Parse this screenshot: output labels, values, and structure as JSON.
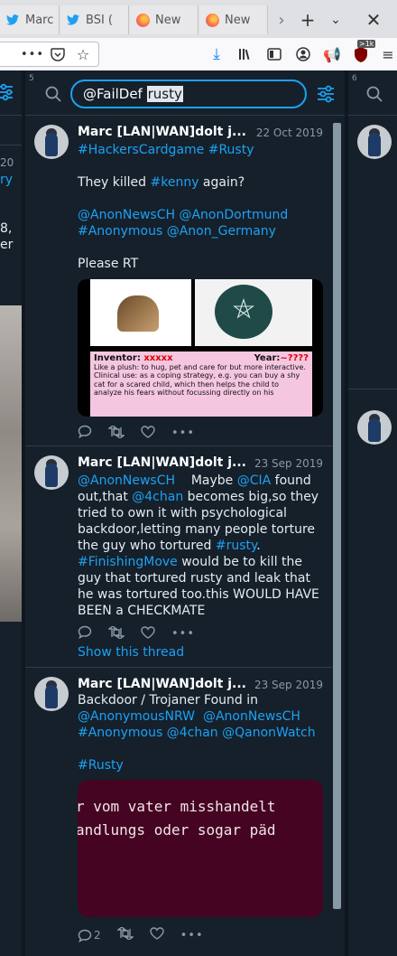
{
  "browser": {
    "tabs": [
      {
        "label": "Marc",
        "icon": "twitter-icon"
      },
      {
        "label": "BSI (",
        "icon": "twitter-icon"
      },
      {
        "label": "New",
        "icon": "firefox-icon"
      },
      {
        "label": "New",
        "icon": "firefox-icon"
      }
    ],
    "addon_badge": ">1k"
  },
  "deck": {
    "left_column": {
      "num": "",
      "fragments": [
        "20",
        "ry",
        "8,",
        "er"
      ]
    },
    "main_column": {
      "num": "5",
      "search_prefix": "@FailDef ",
      "search_highlight": "rusty"
    },
    "right_column": {
      "num": "6"
    }
  },
  "tweets": [
    {
      "name": "Marc [LAN|WAN]dolt j...",
      "date": "22 Oct 2019",
      "line1": "#HackersCardgame #Rusty",
      "p1a": "They killed ",
      "p1b": "#kenny",
      "p1c": " again?",
      "p2": "@AnonNewsCH @AnonDortmund",
      "p3": "#Anonymous @Anon_Germany",
      "p4": "Please RT",
      "card": {
        "inventor_label": "Inventor:",
        "inventor_value": "xxxxx",
        "year_label": "Year:",
        "year_value": "~????",
        "desc": "Like a plush: to hug, pet and care for but more interactive.\nClinical use: as a coping strategy, e.g. you can buy a shy cat for a scared child, which then helps the child to analyze his fears without focussing directly on his"
      }
    },
    {
      "name": "Marc [LAN|WAN]dolt j...",
      "date": "23 Sep 2019",
      "l1a": "@AnonNewsCH",
      "l1b": "    Maybe ",
      "l1c": "@CIA",
      "l1d": " found",
      "l2": "out,that ",
      "l2b": "@4chan",
      "l2c": " becomes big,so they",
      "l3": "tried to own it with psychological",
      "l4": "backdoor,letting many people torture",
      "l5": "the guy who tortured ",
      "l5b": "#rusty",
      "l5c": ".",
      "l6": "#FinishingMove",
      "l6b": " would be to kill the",
      "l7": "guy that tortured rusty and leak that",
      "l8": "he was tortured too.this WOULD HAVE",
      "l9": "BEEN a CHECKMATE",
      "thread": "Show this thread"
    },
    {
      "name": "Marc [LAN|WAN]dolt j...",
      "date": "23 Sep 2019",
      "l1": "Backdoor / Trojaner Found in",
      "l2a": "@AnonymousNRW",
      "l2b": "  ",
      "l2c": "@AnonNewsCH",
      "l3a": "#Anonymous",
      "l3b": " ",
      "l3c": "@4chan",
      "l3d": " ",
      "l3e": "@QanonWatch",
      "l4": "#Rusty",
      "image_text1": "r vom vater misshandelt",
      "image_text2": "andlungs oder sogar päd",
      "reply_count": "2"
    }
  ],
  "colors": {
    "accent": "#1da1f2",
    "bg": "#15202b",
    "muted": "#8899a6"
  }
}
